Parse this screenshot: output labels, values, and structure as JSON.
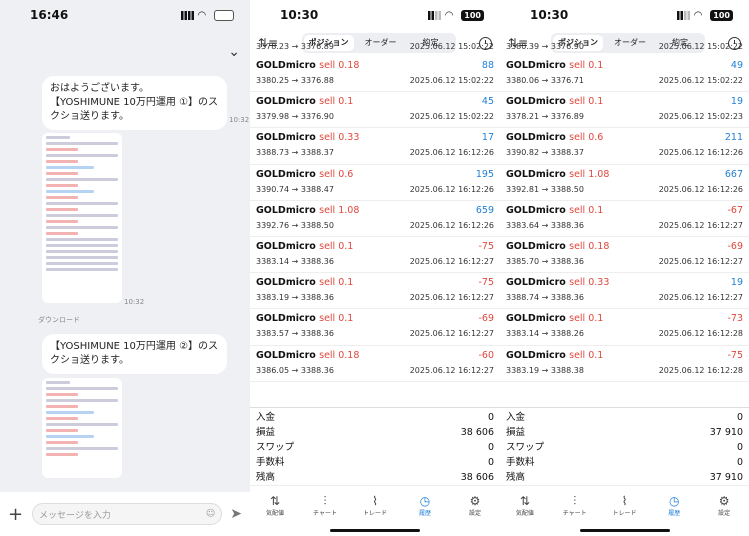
{
  "chat": {
    "time": "16:46",
    "msg1": "おはようございます。\n【YOSHIMUNE 10万円運用 ①】のスクショ送ります。",
    "msg1_time": "10:32",
    "img1_time": "10:32",
    "download": "ダウンロード",
    "msg2": "【YOSHIMUNE 10万円運用 ②】のスクショ送ります。",
    "placeholder": "メッセージを入力"
  },
  "screens": [
    {
      "time": "10:30",
      "battery": "100",
      "tabs": [
        "ポジション",
        "オーダー",
        "約定"
      ],
      "top_row": {
        "price": "3378.23 → 3376.89",
        "date": "2025.06.12 15:02:22"
      },
      "rows": [
        {
          "sym": "GOLDmicro",
          "side": "sell 0.18",
          "profit": "88",
          "price": "3380.25 → 3376.88",
          "date": "2025.06.12 15:02:22",
          "neg": false
        },
        {
          "sym": "GOLDmicro",
          "side": "sell 0.1",
          "profit": "45",
          "price": "3379.98 → 3376.90",
          "date": "2025.06.12 15:02:22",
          "neg": false
        },
        {
          "sym": "GOLDmicro",
          "side": "sell 0.33",
          "profit": "17",
          "price": "3388.73 → 3388.37",
          "date": "2025.06.12 16:12:26",
          "neg": false
        },
        {
          "sym": "GOLDmicro",
          "side": "sell 0.6",
          "profit": "195",
          "price": "3390.74 → 3388.47",
          "date": "2025.06.12 16:12:26",
          "neg": false
        },
        {
          "sym": "GOLDmicro",
          "side": "sell 1.08",
          "profit": "659",
          "price": "3392.76 → 3388.50",
          "date": "2025.06.12 16:12:26",
          "neg": false
        },
        {
          "sym": "GOLDmicro",
          "side": "sell 0.1",
          "profit": "-75",
          "price": "3383.14 → 3388.36",
          "date": "2025.06.12 16:12:27",
          "neg": true
        },
        {
          "sym": "GOLDmicro",
          "side": "sell 0.1",
          "profit": "-75",
          "price": "3383.19 → 3388.36",
          "date": "2025.06.12 16:12:27",
          "neg": true
        },
        {
          "sym": "GOLDmicro",
          "side": "sell 0.1",
          "profit": "-69",
          "price": "3383.57 → 3388.36",
          "date": "2025.06.12 16:12:27",
          "neg": true
        },
        {
          "sym": "GOLDmicro",
          "side": "sell 0.18",
          "profit": "-60",
          "price": "3386.05 → 3388.36",
          "date": "2025.06.12 16:12:27",
          "neg": true
        }
      ],
      "summary": [
        {
          "label": "入金",
          "value": "0"
        },
        {
          "label": "損益",
          "value": "38 606"
        },
        {
          "label": "スワップ",
          "value": "0"
        },
        {
          "label": "手数料",
          "value": "0"
        },
        {
          "label": "残高",
          "value": "38 606"
        }
      ],
      "nav": [
        "気配値",
        "チャート",
        "トレード",
        "履歴",
        "設定"
      ]
    },
    {
      "time": "10:30",
      "battery": "100",
      "tabs": [
        "ポジション",
        "オーダー",
        "約定"
      ],
      "top_row": {
        "price": "3380.39 → 3376.90",
        "date": "2025.06.12 15:02:22"
      },
      "rows": [
        {
          "sym": "GOLDmicro",
          "side": "sell 0.1",
          "profit": "49",
          "price": "3380.06 → 3376.71",
          "date": "2025.06.12 15:02:22",
          "neg": false
        },
        {
          "sym": "GOLDmicro",
          "side": "sell 0.1",
          "profit": "19",
          "price": "3378.21 → 3376.89",
          "date": "2025.06.12 15:02:23",
          "neg": false
        },
        {
          "sym": "GOLDmicro",
          "side": "sell 0.6",
          "profit": "211",
          "price": "3390.82 → 3388.37",
          "date": "2025.06.12 16:12:26",
          "neg": false
        },
        {
          "sym": "GOLDmicro",
          "side": "sell 1.08",
          "profit": "667",
          "price": "3392.81 → 3388.50",
          "date": "2025.06.12 16:12:26",
          "neg": false
        },
        {
          "sym": "GOLDmicro",
          "side": "sell 0.1",
          "profit": "-67",
          "price": "3383.64 → 3388.36",
          "date": "2025.06.12 16:12:27",
          "neg": true
        },
        {
          "sym": "GOLDmicro",
          "side": "sell 0.18",
          "profit": "-69",
          "price": "3385.70 → 3388.36",
          "date": "2025.06.12 16:12:27",
          "neg": true
        },
        {
          "sym": "GOLDmicro",
          "side": "sell 0.33",
          "profit": "19",
          "price": "3388.74 → 3388.36",
          "date": "2025.06.12 16:12:27",
          "neg": false
        },
        {
          "sym": "GOLDmicro",
          "side": "sell 0.1",
          "profit": "-73",
          "price": "3383.14 → 3388.26",
          "date": "2025.06.12 16:12:28",
          "neg": true
        },
        {
          "sym": "GOLDmicro",
          "side": "sell 0.1",
          "profit": "-75",
          "price": "3383.19 → 3388.38",
          "date": "2025.06.12 16:12:28",
          "neg": true
        }
      ],
      "summary": [
        {
          "label": "入金",
          "value": "0"
        },
        {
          "label": "損益",
          "value": "37 910"
        },
        {
          "label": "スワップ",
          "value": "0"
        },
        {
          "label": "手数料",
          "value": "0"
        },
        {
          "label": "残高",
          "value": "37 910"
        }
      ],
      "nav": [
        "気配値",
        "チャート",
        "トレード",
        "履歴",
        "設定"
      ]
    }
  ]
}
